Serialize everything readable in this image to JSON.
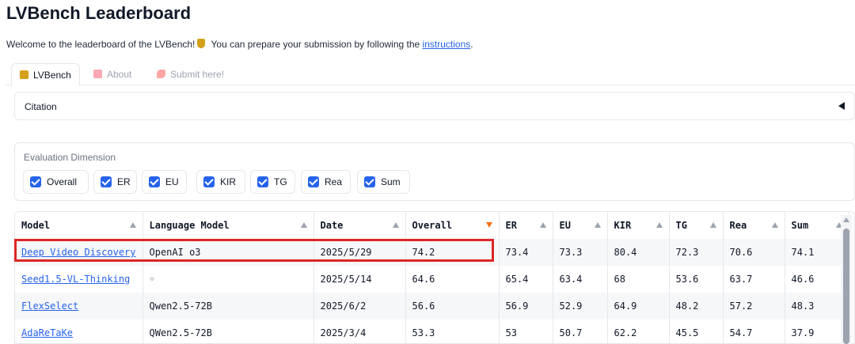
{
  "page": {
    "title": "LVBench Leaderboard",
    "welcome_prefix": "Welcome to the leaderboard of the LVBench!",
    "welcome_middle": " You can prepare your submission by following the ",
    "welcome_link": "instructions",
    "welcome_suffix": "."
  },
  "tabs": [
    {
      "label": "LVBench",
      "icon": "trophy-icon",
      "active": true
    },
    {
      "label": "About",
      "icon": "memo-icon",
      "active": false
    },
    {
      "label": "Submit here!",
      "icon": "rocket-icon",
      "active": false
    }
  ],
  "citation": {
    "label": "Citation"
  },
  "eval_dimension": {
    "label": "Evaluation Dimension",
    "options": [
      {
        "label": "Overall",
        "checked": true
      },
      {
        "label": "ER",
        "checked": true
      },
      {
        "label": "EU",
        "checked": true
      },
      {
        "label": "KIR",
        "checked": true
      },
      {
        "label": "TG",
        "checked": true
      },
      {
        "label": "Rea",
        "checked": true
      },
      {
        "label": "Sum",
        "checked": true
      }
    ]
  },
  "table": {
    "headers": [
      "Model",
      "Language Model",
      "Date",
      "Overall",
      "ER",
      "EU",
      "KIR",
      "TG",
      "Rea",
      "Sum"
    ],
    "sorted_column": "Overall",
    "rows": [
      [
        "Deep Video Discovery",
        "OpenAI o3",
        "2025/5/29",
        "74.2",
        "73.4",
        "73.3",
        "80.4",
        "72.3",
        "70.6",
        "74.1"
      ],
      [
        "Seed1.5-VL-Thinking",
        "◦",
        "2025/5/14",
        "64.6",
        "65.4",
        "63.4",
        "68",
        "53.6",
        "63.7",
        "46.6"
      ],
      [
        "FlexSelect",
        "Qwen2.5-72B",
        "2025/6/2",
        "56.6",
        "56.9",
        "52.9",
        "64.9",
        "48.2",
        "57.2",
        "48.3"
      ],
      [
        "AdaReTaKe",
        "QWen2.5-72B",
        "2025/3/4",
        "53.3",
        "53",
        "50.7",
        "62.2",
        "45.5",
        "54.7",
        "37.9"
      ]
    ]
  },
  "colors": {
    "link": "#2563eb",
    "checkbox": "#2563eb",
    "highlight": "#dc2626",
    "sort_active": "#f97316"
  }
}
